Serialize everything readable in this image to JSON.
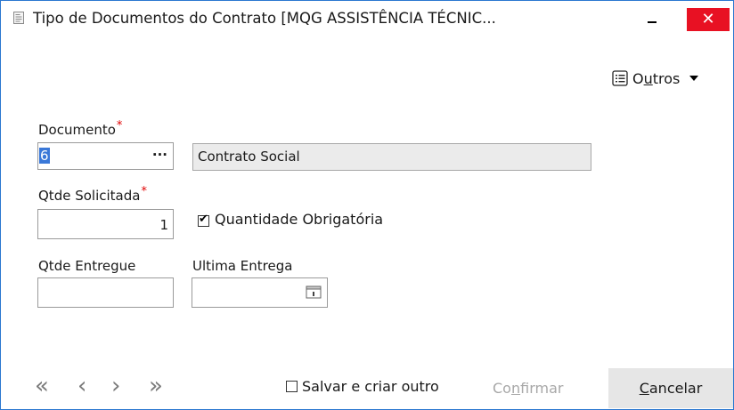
{
  "window": {
    "title": "Tipo de Documentos do Contrato [MQG ASSISTÊNCIA TÉCNIC...",
    "minimize": "–",
    "close": "✕"
  },
  "toolbar": {
    "outros_label_pre": "O",
    "outros_label_u": "u",
    "outros_label_post": "tros"
  },
  "form": {
    "documento_label": "Documento",
    "documento_value": "6",
    "documento_lookup": "···",
    "documento_desc": "Contrato Social",
    "qtde_solicitada_label": "Qtde Solicitada",
    "qtde_solicitada_value": "1",
    "quantidade_obrigatoria_label": "Quantidade Obrigatória",
    "quantidade_obrigatoria_checked": true,
    "qtde_entregue_label": "Qtde Entregue",
    "qtde_entregue_value": "",
    "ultima_entrega_label": "Ultima Entrega",
    "ultima_entrega_value": "",
    "required_marker": "*"
  },
  "footer": {
    "first": "«",
    "prev": "‹",
    "next": "›",
    "last": "»",
    "salvar_label": "Salvar e criar outro",
    "salvar_checked": false,
    "confirmar_pre": "Co",
    "confirmar_u": "n",
    "confirmar_post": "firmar",
    "cancelar_u": "C",
    "cancelar_post": "ancelar"
  }
}
